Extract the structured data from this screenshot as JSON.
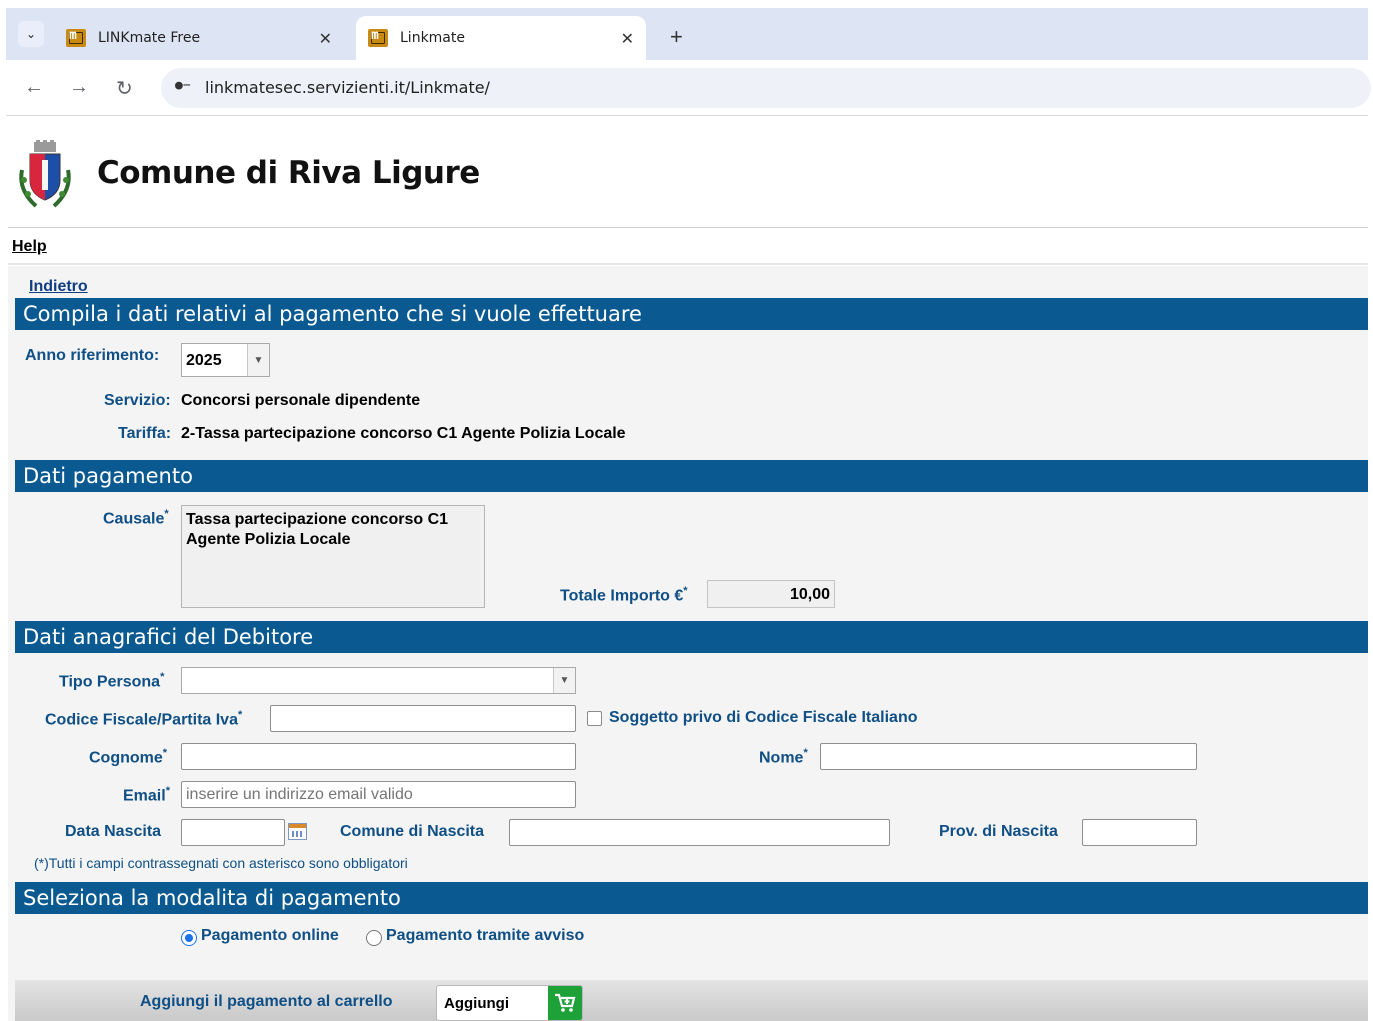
{
  "browser": {
    "tabs": [
      {
        "title": "LINKmate Free",
        "active": false
      },
      {
        "title": "Linkmate",
        "active": true
      }
    ],
    "url": "linkmatesec.servizienti.it/Linkmate/"
  },
  "header": {
    "title": "Comune di Riva Ligure",
    "help": "Help",
    "back": "Indietro"
  },
  "sections": {
    "s1": "Compila i dati relativi al pagamento che si vuole effettuare",
    "s2": "Dati pagamento",
    "s3": "Dati anagrafici del Debitore",
    "s4": "Seleziona la modalita di pagamento"
  },
  "riferimento": {
    "anno_label": "Anno riferimento:",
    "anno_value": "2025",
    "servizio_label": "Servizio:",
    "servizio_value": "Concorsi personale dipendente",
    "tariffa_label": "Tariffa:",
    "tariffa_value": "2-Tassa partecipazione concorso C1 Agente Polizia Locale"
  },
  "pagamento": {
    "causale_label": "Causale",
    "causale_line1": "Tassa partecipazione concorso C1",
    "causale_line2": "Agente Polizia Locale",
    "totale_label": "Totale Importo €",
    "totale_value": "10,00"
  },
  "debitore": {
    "tipo_label": "Tipo Persona",
    "tipo_value": "",
    "cf_label": "Codice Fiscale/Partita Iva",
    "cf_value": "",
    "no_cf_label": "Soggetto privo di Codice Fiscale Italiano",
    "cognome_label": "Cognome",
    "nome_label": "Nome",
    "email_label": "Email",
    "email_placeholder": "inserire un indirizzo email valido",
    "data_label": "Data Nascita",
    "comune_label": "Comune di Nascita",
    "prov_label": "Prov. di Nascita",
    "note": "(*)Tutti i campi contrassegnati con asterisco sono obbligatori",
    "asterisk": "*"
  },
  "modalita": {
    "online": "Pagamento online",
    "avviso": "Pagamento tramite avviso",
    "selected": "online"
  },
  "footer": {
    "label": "Aggiungi il pagamento al carrello",
    "button": "Aggiungi"
  },
  "colors": {
    "section_bg": "#0a5a91",
    "label": "#0f4f86",
    "cart": "#1fa13a"
  }
}
